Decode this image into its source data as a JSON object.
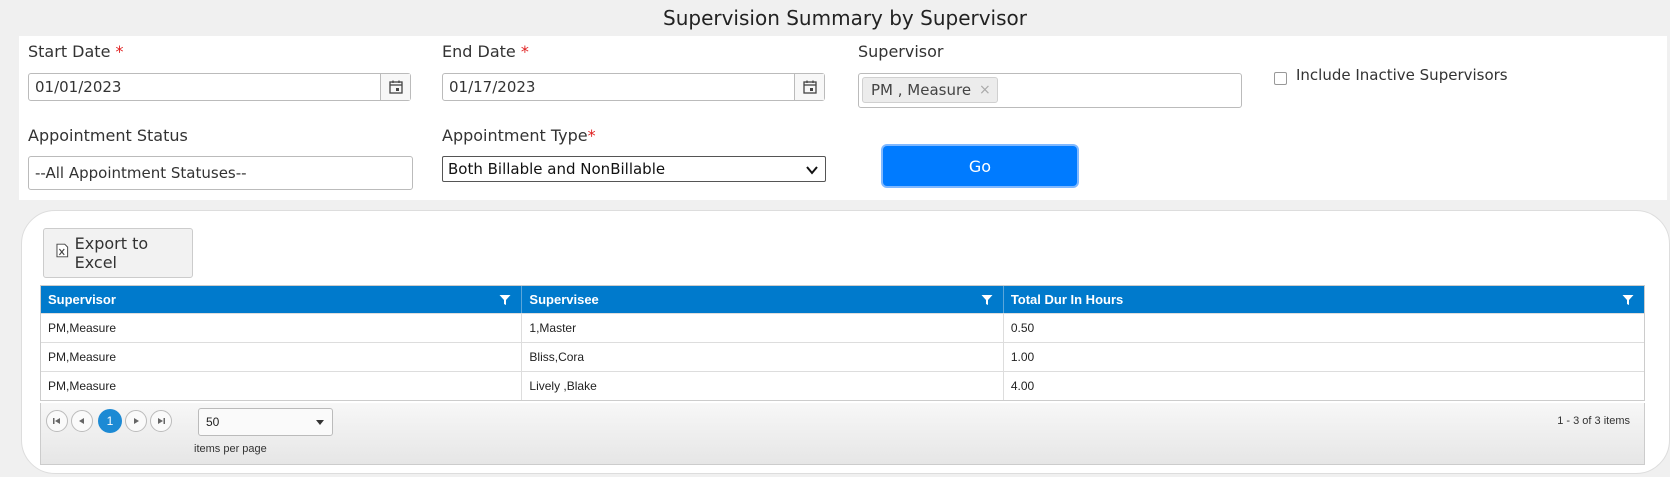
{
  "page": {
    "title": "Supervision Summary by Supervisor"
  },
  "filters": {
    "start_date": {
      "label": "Start Date",
      "required_mark": "*",
      "value": "01/01/2023"
    },
    "end_date": {
      "label": "End Date",
      "required_mark": "*",
      "value": "01/17/2023"
    },
    "supervisor": {
      "label": "Supervisor",
      "selected_tag": "PM , Measure",
      "remove_glyph": "×"
    },
    "include_inactive": {
      "label": "Include Inactive Supervisors",
      "checked": false
    },
    "appointment_status": {
      "label": "Appointment Status",
      "value": "--All Appointment Statuses--"
    },
    "appointment_type": {
      "label": "Appointment Type",
      "required_mark": "*",
      "value": "Both Billable and NonBillable"
    },
    "go_label": "Go"
  },
  "results": {
    "export_label": "Export to Excel",
    "columns": [
      "Supervisor",
      "Supervisee",
      "Total Dur In Hours"
    ],
    "rows": [
      [
        "PM,Measure",
        "1,Master",
        "0.50"
      ],
      [
        "PM,Measure",
        "Bliss,Cora",
        "1.00"
      ],
      [
        "PM,Measure",
        "Lively ,Blake",
        "4.00"
      ]
    ],
    "pager": {
      "current_page": "1",
      "page_size": "50",
      "items_per_page_label": "items per page",
      "info": "1 - 3 of 3 items"
    }
  },
  "colors": {
    "accent": "#007bff",
    "grid_header": "#007acc",
    "required": "#e02020"
  },
  "icons": [
    "calendar-icon",
    "excel-icon",
    "filter-icon",
    "chevron-down-icon",
    "first-page-icon",
    "prev-page-icon",
    "next-page-icon",
    "last-page-icon",
    "close-icon"
  ]
}
